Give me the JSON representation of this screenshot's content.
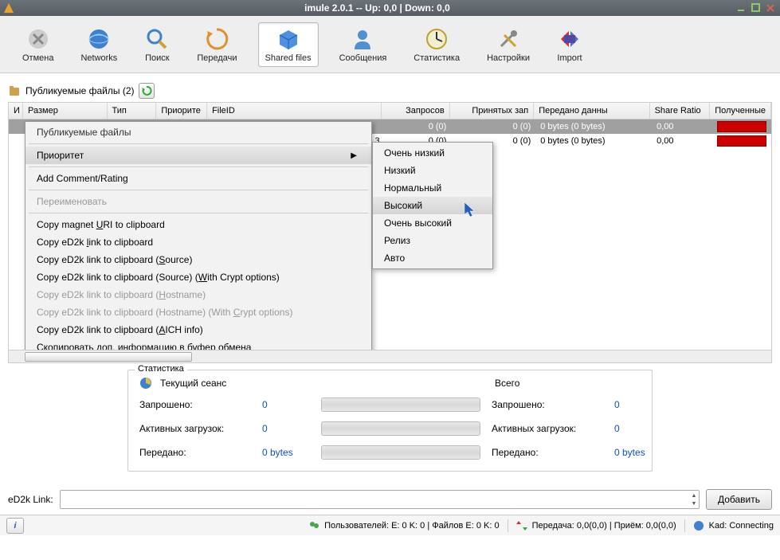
{
  "window": {
    "title": "imule 2.0.1 -- Up: 0,0 | Down: 0,0"
  },
  "toolbar": {
    "cancel": "Отмена",
    "networks": "Networks",
    "search": "Поиск",
    "transfers": "Передачи",
    "shared": "Shared files",
    "messages": "Сообщения",
    "stats": "Статистика",
    "settings": "Настройки",
    "import": "Import"
  },
  "section": {
    "title": "Публикуемые файлы (2)"
  },
  "columns": {
    "i": "И",
    "size": "Размер",
    "type": "Тип",
    "priority": "Приорите",
    "fileid": "FileID",
    "requests": "Запросов",
    "accepted": "Принятых зап",
    "transferred": "Передано данны",
    "ratio": "Share Ratio",
    "obtained": "Полученные"
  },
  "rows": [
    {
      "c5": "0 (0)",
      "c6": "0 (0)",
      "c7": "0 bytes (0 bytes)",
      "c8": "0,00"
    },
    {
      "prefix": "3",
      "c5": "0 (0)",
      "c6": "0 (0)",
      "c7": "0 bytes (0 bytes)",
      "c8": "0,00"
    }
  ],
  "ctx": {
    "heading": "Публикуемые файлы",
    "priority": "Приоритет",
    "addcomment": "Add Comment/Rating",
    "rename": "Переименовать",
    "magnet_pre": "Copy magnet ",
    "magnet_u": "U",
    "magnet_post": "RI to clipboard",
    "ed2k_l_pre": "Copy eD2k ",
    "ed2k_l_u": "l",
    "ed2k_l_post": "ink to clipboard",
    "ed2k_s_pre": "Copy eD2k link to clipboard (",
    "ed2k_s_u": "S",
    "ed2k_s_post": "ource)",
    "ed2k_sw_pre": "Copy eD2k link to clipboard (Source) (",
    "ed2k_sw_u": "W",
    "ed2k_sw_post": "ith Crypt options)",
    "ed2k_h_pre": "Copy eD2k link to clipboard (",
    "ed2k_h_u": "H",
    "ed2k_h_post": "ostname)",
    "ed2k_hc_pre": "Copy eD2k link to clipboard (Hostname) (With ",
    "ed2k_hc_u": "C",
    "ed2k_hc_post": "rypt options)",
    "ed2k_a_pre": "Copy eD2k link to clipboard (",
    "ed2k_a_u": "A",
    "ed2k_a_post": "ICH info)",
    "copyextra": "Скопировать доп. информацию в буфер обмена"
  },
  "submenu": {
    "vlow": "Очень низкий",
    "low": "Низкий",
    "normal": "Нормальный",
    "high": "Высокий",
    "vhigh": "Очень высокий",
    "release": "Релиз",
    "auto": "Авто"
  },
  "stats": {
    "title": "Статистика",
    "session": "Текущий сеанс",
    "total": "Всего",
    "requested": "Запрошено:",
    "active": "Активных загрузок:",
    "transferred": "Передано:",
    "v_req1": "0",
    "v_act1": "0",
    "v_tr1": "0 bytes",
    "v_req2": "0",
    "v_act2": "0",
    "v_tr2": "0 bytes"
  },
  "linkbar": {
    "label": "eD2k Link:",
    "button": "Добавить"
  },
  "status": {
    "users": "Пользователей: E: 0 K: 0 | Файлов E: 0 K: 0",
    "transfer": "Передача: 0,0(0,0) | Приём: 0,0(0,0)",
    "kad": "Kad: Connecting"
  }
}
